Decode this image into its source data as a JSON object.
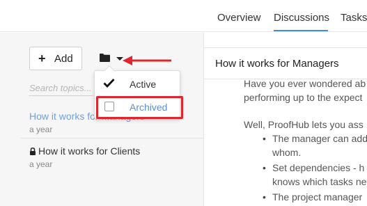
{
  "tabs": [
    {
      "label": "Overview"
    },
    {
      "label": "Discussions",
      "active": true
    },
    {
      "label": "Tasks"
    }
  ],
  "sidebar": {
    "add_label": "Add",
    "search_placeholder": "Search topics...",
    "topics": [
      {
        "title": "How it works for Managers",
        "date": "a year",
        "locked": false
      },
      {
        "title": "How it works for Clients",
        "date": "a year",
        "locked": true
      }
    ]
  },
  "filter_menu": {
    "items": [
      {
        "label": "Active",
        "checked": true
      },
      {
        "label": "Archived",
        "checked": false
      }
    ]
  },
  "document": {
    "title": "How it works for Managers",
    "para1_line1": "Have you ever wondered ab",
    "para1_line2": "performing up to the expect",
    "para2": "Well, ProofHub lets you ass",
    "bullets": [
      {
        "line1": "The manager can add",
        "line2": "whom."
      },
      {
        "line1": "Set dependencies - h",
        "line2": "knows which tasks ne"
      },
      {
        "line1": "The project manager"
      }
    ]
  },
  "colors": {
    "accent": "#3e8fd8",
    "link": "#6b9fe0",
    "annotation": "#e0262c"
  }
}
